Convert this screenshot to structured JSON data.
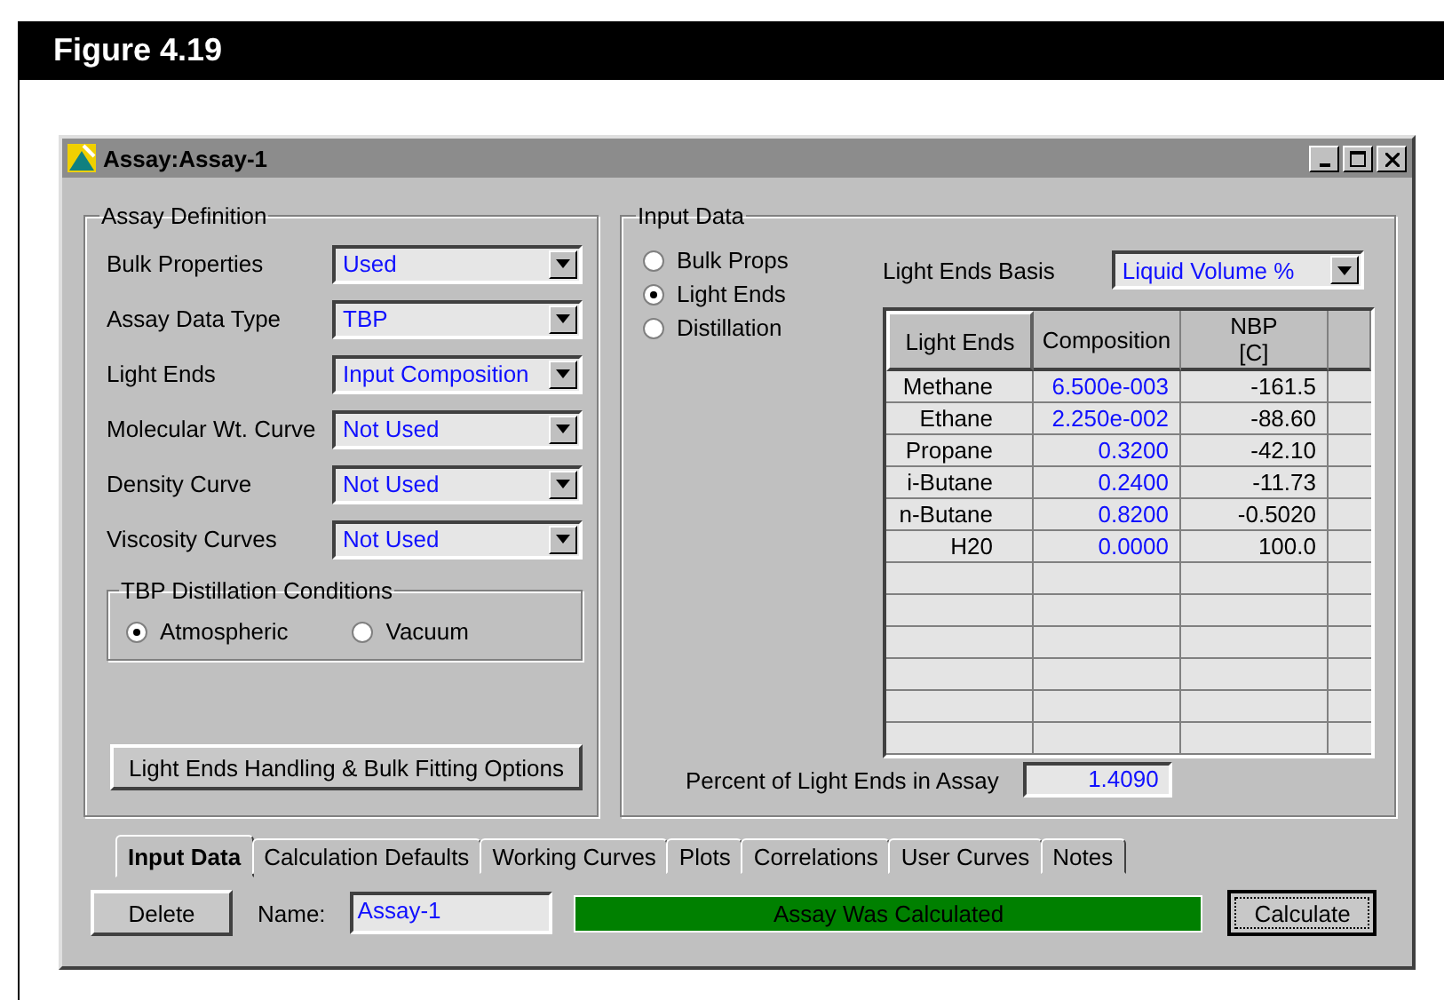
{
  "figure_caption": "Figure 4.19",
  "window": {
    "title": "Assay:Assay-1"
  },
  "assay_definition": {
    "title": "Assay Definition",
    "fields": [
      {
        "label": "Bulk Properties",
        "value": "Used"
      },
      {
        "label": "Assay Data Type",
        "value": "TBP"
      },
      {
        "label": "Light Ends",
        "value": "Input Composition"
      },
      {
        "label": "Molecular Wt. Curve",
        "value": "Not Used"
      },
      {
        "label": "Density Curve",
        "value": "Not Used"
      },
      {
        "label": "Viscosity Curves",
        "value": "Not Used"
      }
    ],
    "distillation_conditions": {
      "title": "TBP Distillation Conditions",
      "options": [
        {
          "label": "Atmospheric",
          "selected": true
        },
        {
          "label": "Vacuum",
          "selected": false
        }
      ]
    },
    "options_button": "Light Ends Handling & Bulk Fitting Options"
  },
  "input_data": {
    "title": "Input Data",
    "views": [
      {
        "label": "Bulk Props",
        "selected": false
      },
      {
        "label": "Light Ends",
        "selected": true
      },
      {
        "label": "Distillation",
        "selected": false
      }
    ],
    "basis": {
      "label": "Light Ends Basis",
      "value": "Liquid Volume %"
    },
    "table": {
      "columns": [
        "Light Ends",
        "Composition",
        "NBP\n[C]"
      ],
      "rows": [
        [
          "Methane",
          "6.500e-003",
          "-161.5"
        ],
        [
          "Ethane",
          "2.250e-002",
          "-88.60"
        ],
        [
          "Propane",
          "0.3200",
          "-42.10"
        ],
        [
          "i-Butane",
          "0.2400",
          "-11.73"
        ],
        [
          "n-Butane",
          "0.8200",
          "-0.5020"
        ],
        [
          "H20",
          "0.0000",
          "100.0"
        ]
      ]
    },
    "percent": {
      "label": "Percent of Light Ends in Assay",
      "value": "1.4090"
    }
  },
  "tabs": [
    {
      "label": "Input Data",
      "selected": true
    },
    {
      "label": "Calculation Defaults",
      "selected": false
    },
    {
      "label": "Working Curves",
      "selected": false
    },
    {
      "label": "Plots",
      "selected": false
    },
    {
      "label": "Correlations",
      "selected": false
    },
    {
      "label": "User Curves",
      "selected": false
    },
    {
      "label": "Notes",
      "selected": false
    }
  ],
  "footer": {
    "delete_button": "Delete",
    "name_label": "Name:",
    "name_value": "Assay-1",
    "status": "Assay Was Calculated",
    "calculate_button": "Calculate"
  }
}
